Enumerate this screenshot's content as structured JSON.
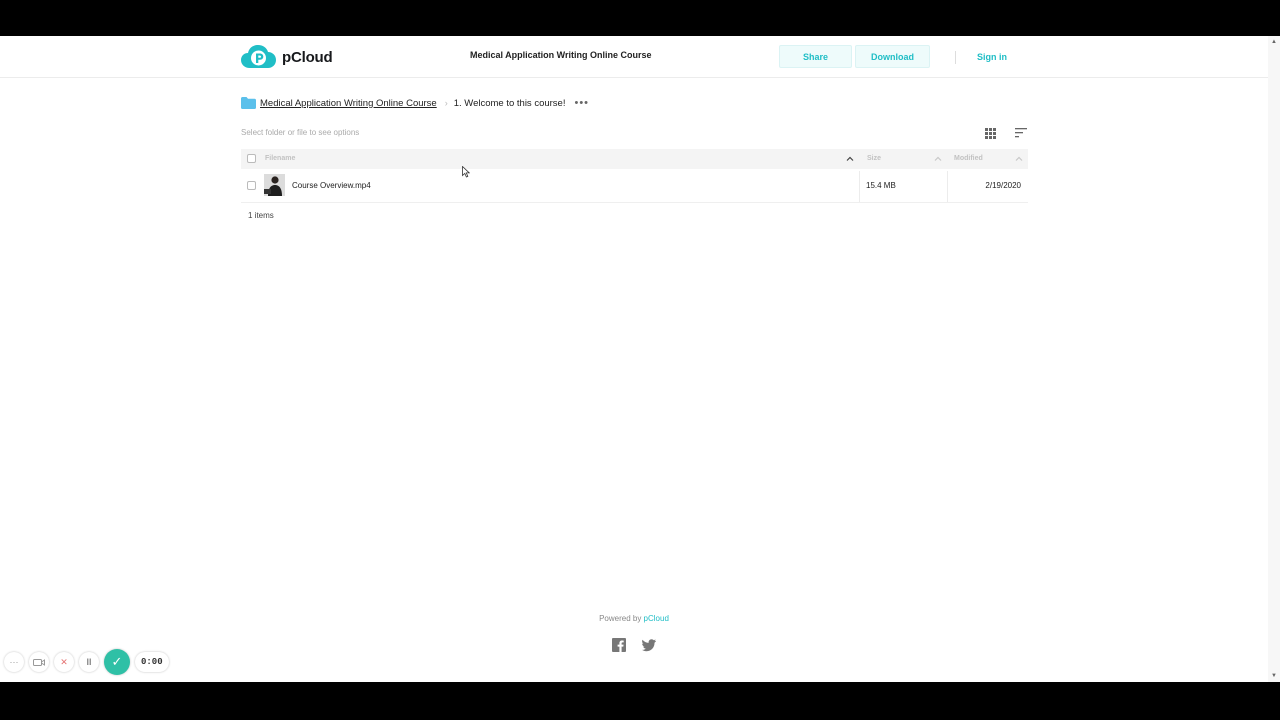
{
  "header": {
    "logo_text": "pCloud",
    "title": "Medical Application Writing Online Course",
    "share_label": "Share",
    "download_label": "Download",
    "signin_label": "Sign in"
  },
  "breadcrumb": {
    "parent": "Medical Application Writing Online Course",
    "separator": "›",
    "current": "1. Welcome to this course!",
    "more": "•••"
  },
  "toolbar": {
    "hint": "Select folder or file to see options"
  },
  "table": {
    "columns": [
      "Filename",
      "Size",
      "Modified"
    ],
    "rows": [
      {
        "name": "Course Overview.mp4",
        "size": "15.4 MB",
        "modified": "2/19/2020"
      }
    ],
    "count_text": "1 items"
  },
  "footer": {
    "powered_by": "Powered by ",
    "brand": "pCloud"
  },
  "recorder": {
    "menu": "···",
    "close": "✕",
    "pause": "II",
    "done": "✓",
    "time": "0:00"
  },
  "colors": {
    "accent": "#20bec6",
    "folder": "#5bc0eb",
    "recorder_ok": "#2fc0a6"
  }
}
